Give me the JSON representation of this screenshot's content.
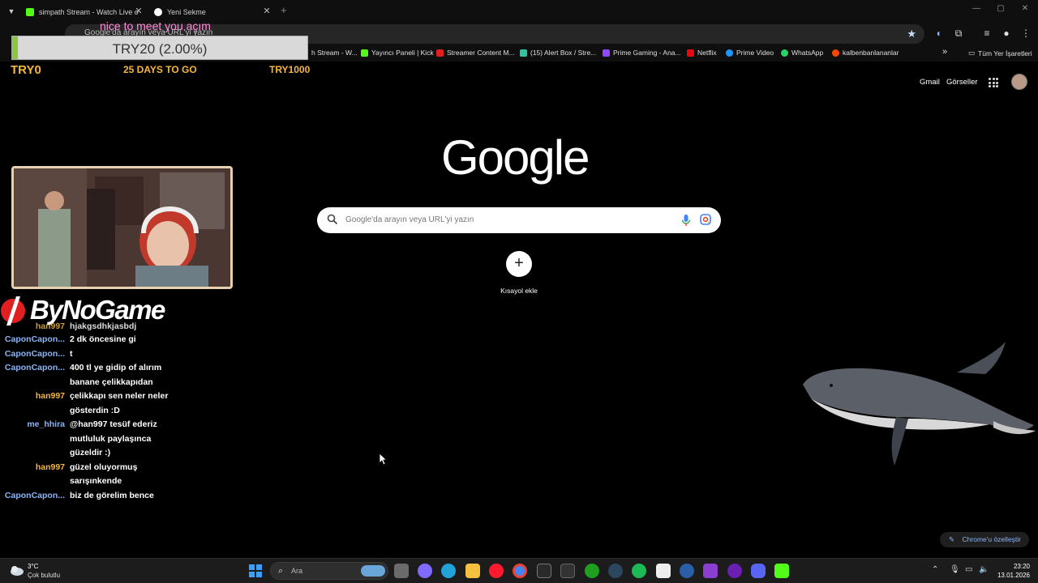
{
  "browser": {
    "tabs": [
      {
        "title": "simpath Stream - Watch Live o",
        "favicon_color": "#53fc18",
        "active": false
      },
      {
        "title": "Yeni Sekme",
        "favicon_color": "#ffffff",
        "active": true
      }
    ],
    "window_controls": {
      "minimize": "—",
      "maximize": "▢",
      "close": "✕"
    },
    "omnibox_text": "Google'da arayın veya URL'yi yazın",
    "bookmarks": [
      {
        "label": "h Stream - W...",
        "icon_color": "#53fc18"
      },
      {
        "label": "Yayıncı Paneli | Kick",
        "icon_color": "#53fc18"
      },
      {
        "label": "Streamer Content M...",
        "icon_color": "#e02020"
      },
      {
        "label": "(15) Alert Box / Stre...",
        "icon_color": "#31c3a2"
      },
      {
        "label": "Prime Gaming - Ana...",
        "icon_color": "#9146ff"
      },
      {
        "label": "Netflix",
        "icon_color": "#e50914"
      },
      {
        "label": "Prime Video",
        "icon_color": "#1a98ff"
      },
      {
        "label": "WhatsApp",
        "icon_color": "#25d366"
      },
      {
        "label": "kalbenbanlananlar",
        "icon_color": "#ff4500"
      }
    ],
    "bookmarks_more": "»",
    "all_bookmarks": "Tüm Yer İşaretleri"
  },
  "overlay": {
    "goal": {
      "amount_text": "TRY20 (2.00%)",
      "progress": 0.02,
      "message": "nice to meet you açım",
      "min_label": "TRY0",
      "days_label": "25 DAYS TO GO",
      "max_label": "TRY1000"
    },
    "sponsor_logo_text": "ByNoGame",
    "chat": [
      {
        "user": "han997",
        "user_color": "#f6b73c",
        "message": "hjakgsdhkjasbdj"
      },
      {
        "user": "CaponCapon...",
        "user_color": "#8ab4f8",
        "message": "2 dk öncesine gi"
      },
      {
        "user": "CaponCapon...",
        "user_color": "#8ab4f8",
        "message": "t"
      },
      {
        "user": "CaponCapon...",
        "user_color": "#8ab4f8",
        "message": "400 tl ye gidip of alırım banane çelikkapıdan"
      },
      {
        "user": "han997",
        "user_color": "#f6b73c",
        "message": "çelikkapı sen neler neler gösterdin :D"
      },
      {
        "user": "me_hhira",
        "user_color": "#8ab4f8",
        "message": "@han997 tesüf ederiz mutluluk paylaşınca güzeldir :)"
      },
      {
        "user": "han997",
        "user_color": "#f6b73c",
        "message": "güzel oluyormuş sarışınkende"
      },
      {
        "user": "CaponCapon...",
        "user_color": "#8ab4f8",
        "message": "biz de görelim bence"
      }
    ]
  },
  "ntp": {
    "gmail": "Gmail",
    "images": "Görseller",
    "logo": "Google",
    "search_placeholder": "Google'da arayın veya URL'yi yazın",
    "shortcut_plus": "+",
    "shortcut_label": "Kısayol ekle",
    "customize_label": "Chrome'u özelleştir"
  },
  "taskbar": {
    "weather_temp": "3°C",
    "weather_desc": "Çok bulutlu",
    "search_label": "Ara",
    "apps": [
      {
        "name": "task-view",
        "color": "#6b6b6b"
      },
      {
        "name": "copilot",
        "color": "#7f6bff"
      },
      {
        "name": "edge",
        "color": "#1fa3d8"
      },
      {
        "name": "file-explorer",
        "color": "#f5c03f"
      },
      {
        "name": "opera",
        "color": "#ff1b2d"
      },
      {
        "name": "chrome",
        "color": "#4285f4"
      },
      {
        "name": "epic-games",
        "color": "#2a2a2a"
      },
      {
        "name": "amazon",
        "color": "#333333"
      },
      {
        "name": "xbox",
        "color": "#1f9f1f"
      },
      {
        "name": "steam",
        "color": "#2a475e"
      },
      {
        "name": "spotify",
        "color": "#1db954"
      },
      {
        "name": "capcut",
        "color": "#eeeeee"
      },
      {
        "name": "ubisoft",
        "color": "#2b5ea8"
      },
      {
        "name": "clipchamp",
        "color": "#8a3fd1"
      },
      {
        "name": "obs",
        "color": "#6a1fb0"
      },
      {
        "name": "discord",
        "color": "#5865f2"
      },
      {
        "name": "kick",
        "color": "#53fc18"
      }
    ],
    "time": "23:20",
    "date": "13.01.2026"
  }
}
